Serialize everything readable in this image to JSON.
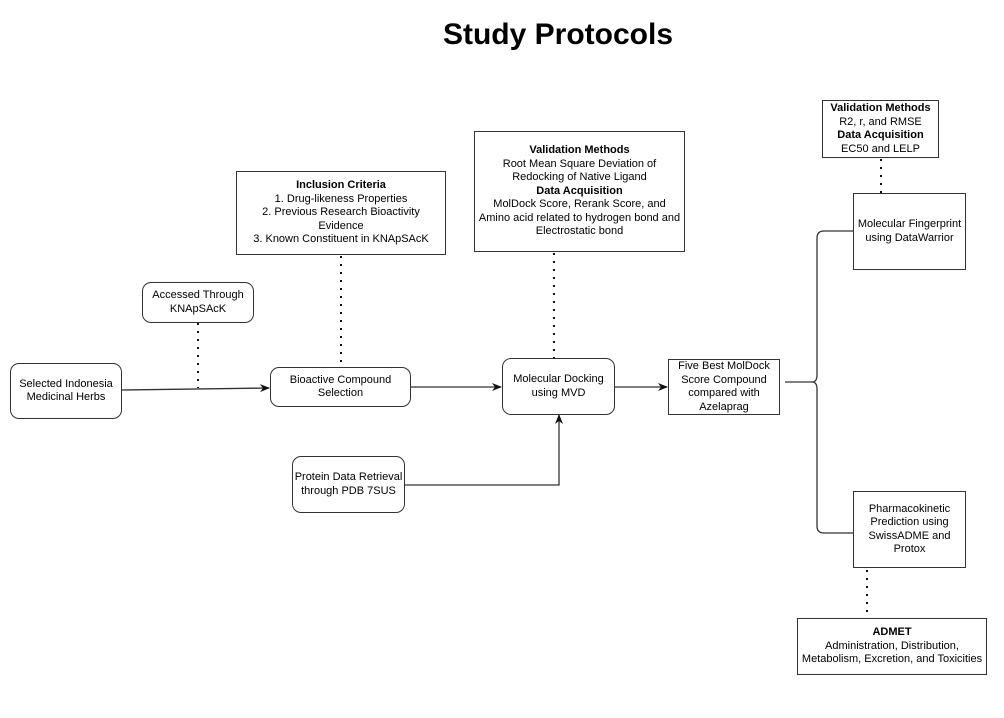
{
  "title": "Study Protocols",
  "nodes": {
    "herbs": {
      "lines": [
        "Selected Indonesia",
        "Medicinal Herbs"
      ]
    },
    "knapsack": {
      "lines": [
        "Accessed Through",
        "KNApSAcK"
      ]
    },
    "inclusion": {
      "heading": "Inclusion Criteria",
      "lines": [
        "1. Drug-likeness Properties",
        "2. Previous Research Bioactivity",
        "Evidence",
        "3. Known Constituent in KNApSAcK"
      ]
    },
    "bioactive": {
      "lines": [
        "Bioactive Compound",
        "Selection"
      ]
    },
    "docking_validation": {
      "heading1": "Validation Methods",
      "lines1": [
        "Root Mean Square Deviation of",
        "Redocking of Native Ligand"
      ],
      "heading2": "Data Acquisition",
      "lines2": [
        "MolDock Score, Rerank Score, and",
        "Amino acid related to hydrogen bond and",
        "Electrostatic bond"
      ]
    },
    "docking": {
      "lines": [
        "Molecular Docking",
        "using MVD"
      ]
    },
    "protein": {
      "lines": [
        "Protein Data Retrieval",
        "through PDB 7SUS"
      ]
    },
    "five_best": {
      "lines": [
        "Five Best MolDock",
        "Score Compound",
        "compared with",
        "Azelaprag"
      ]
    },
    "fp_validation": {
      "heading1": "Validation Methods",
      "lines1": [
        "R2, r, and RMSE"
      ],
      "heading2": "Data Acquisition",
      "lines2": [
        "EC50 and LELP"
      ]
    },
    "fingerprint": {
      "lines": [
        "Molecular Fingerprint",
        "using DataWarrior"
      ]
    },
    "pharmacokinetic": {
      "lines": [
        "Pharmacokinetic",
        "Prediction using",
        "SwissADME and",
        "Protox"
      ]
    },
    "admet": {
      "heading": "ADMET",
      "lines": [
        "Administration, Distribution,",
        "Metabolism, Excretion, and Toxicities"
      ]
    }
  },
  "colors": {
    "stroke": "#333333",
    "background": "#ffffff",
    "text": "#000000"
  }
}
